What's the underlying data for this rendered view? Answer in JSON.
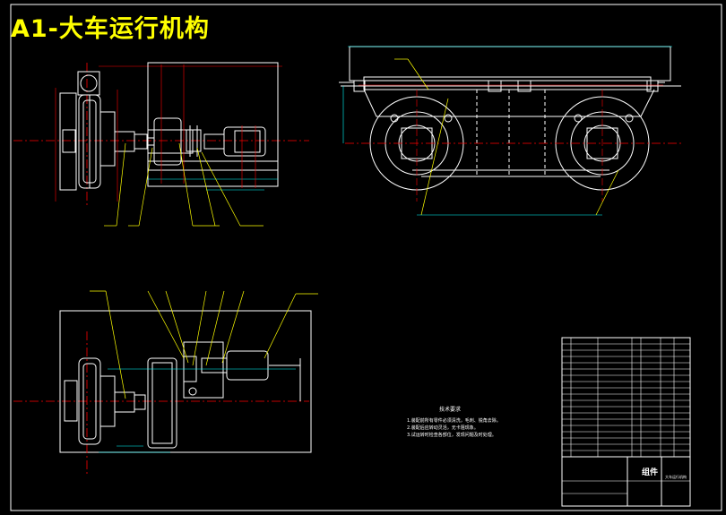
{
  "drawing": {
    "title": "A1-大车运行机构",
    "notes_title": "技术要求",
    "notes": [
      "1.装配前所有零件必须清洗，毛刺、锐角去除。",
      "2.装配后应转动灵活，无卡阻现象。",
      "3.试运转时检查各部位，发现问题及时处理。"
    ],
    "title_block": {
      "part_name": "组件",
      "drawing_name": "大车运行机构"
    }
  },
  "colors": {
    "background": "#000000",
    "outline": "#ffffff",
    "centerline": "#ff0000",
    "leader": "#ffff00",
    "dimension": "#00ffff",
    "title": "#ffff00"
  }
}
